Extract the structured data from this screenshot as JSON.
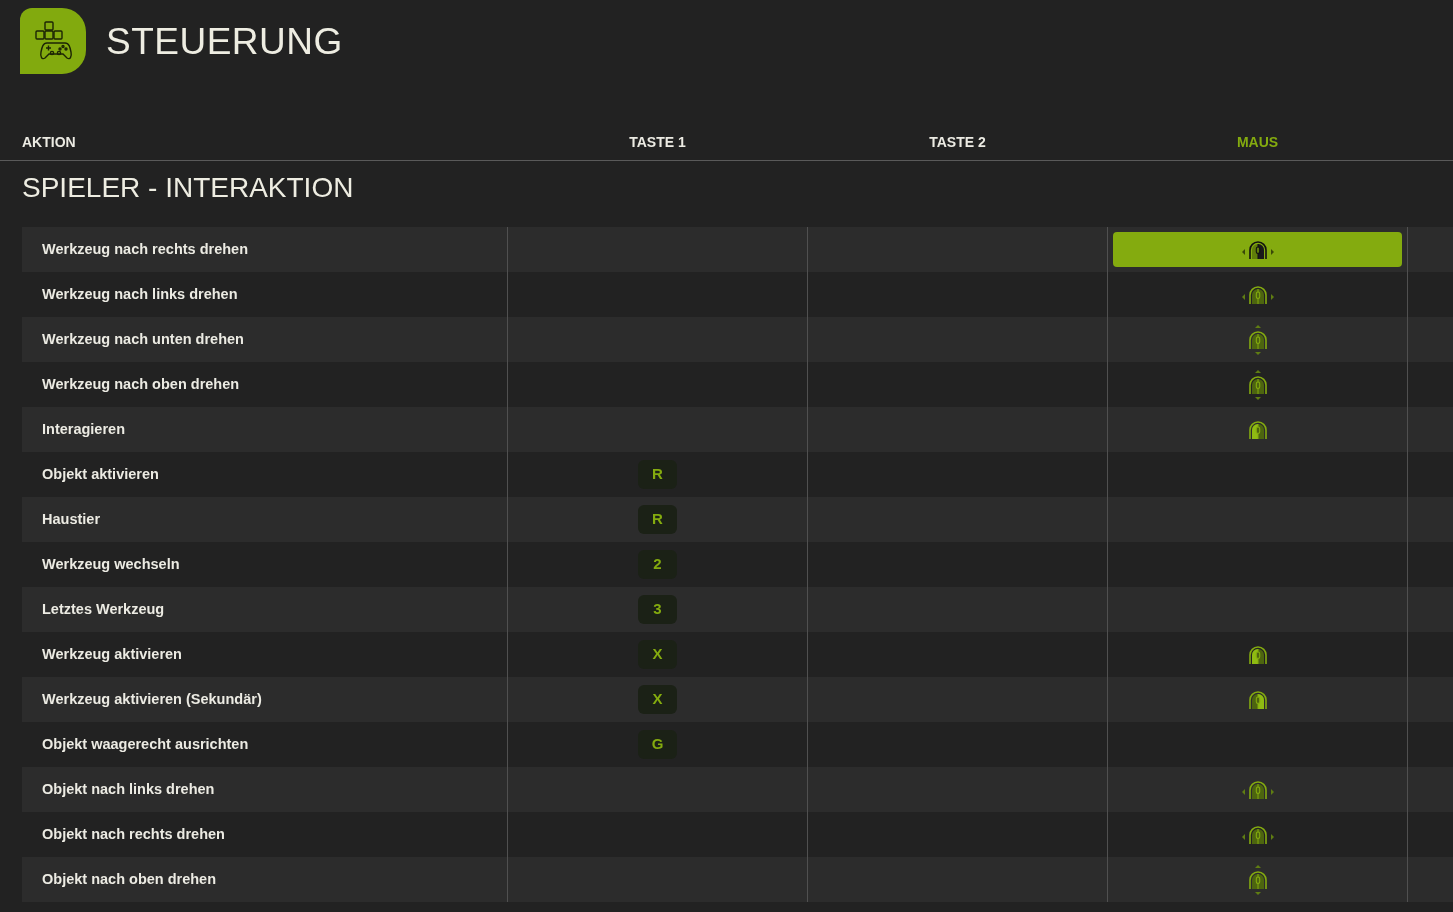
{
  "header": {
    "title": "STEUERUNG"
  },
  "columns": [
    {
      "label": "AKTION",
      "selected": false
    },
    {
      "label": "TASTE 1",
      "selected": false
    },
    {
      "label": "TASTE 2",
      "selected": false
    },
    {
      "label": "MAUS",
      "selected": true
    }
  ],
  "section": {
    "title": "SPIELER - INTERAKTION",
    "rows": [
      {
        "action": "Werkzeug nach rechts drehen",
        "mouse": {
          "kind": "move-x"
        },
        "selected": true
      },
      {
        "action": "Werkzeug nach links drehen",
        "mouse": {
          "kind": "move-x"
        },
        "selected": false
      },
      {
        "action": "Werkzeug nach unten drehen",
        "mouse": {
          "kind": "move-y"
        },
        "selected": false
      },
      {
        "action": "Werkzeug nach oben drehen",
        "mouse": {
          "kind": "move-y"
        },
        "selected": false
      },
      {
        "action": "Interagieren",
        "mouse": {
          "kind": "left-click"
        },
        "selected": false
      },
      {
        "action": "Objekt aktivieren",
        "key_1": "R",
        "selected": false
      },
      {
        "action": "Haustier",
        "key_1": "R",
        "selected": false
      },
      {
        "action": "Werkzeug wechseln",
        "key_1": "2",
        "selected": false
      },
      {
        "action": "Letztes Werkzeug",
        "key_1": "3",
        "selected": false
      },
      {
        "action": "Werkzeug aktivieren",
        "key_1": "X",
        "mouse": {
          "kind": "left-click"
        },
        "selected": false
      },
      {
        "action": "Werkzeug aktivieren (Sekundär)",
        "key_1": "X",
        "mouse": {
          "kind": "right-click"
        },
        "selected": false
      },
      {
        "action": "Objekt waagerecht ausrichten",
        "key_1": "G",
        "selected": false
      },
      {
        "action": "Objekt nach links drehen",
        "mouse": {
          "kind": "move-x"
        },
        "selected": false
      },
      {
        "action": "Objekt nach rechts drehen",
        "mouse": {
          "kind": "move-x"
        },
        "selected": false
      },
      {
        "action": "Objekt nach oben drehen",
        "mouse": {
          "kind": "move-y"
        },
        "selected": false
      }
    ]
  }
}
